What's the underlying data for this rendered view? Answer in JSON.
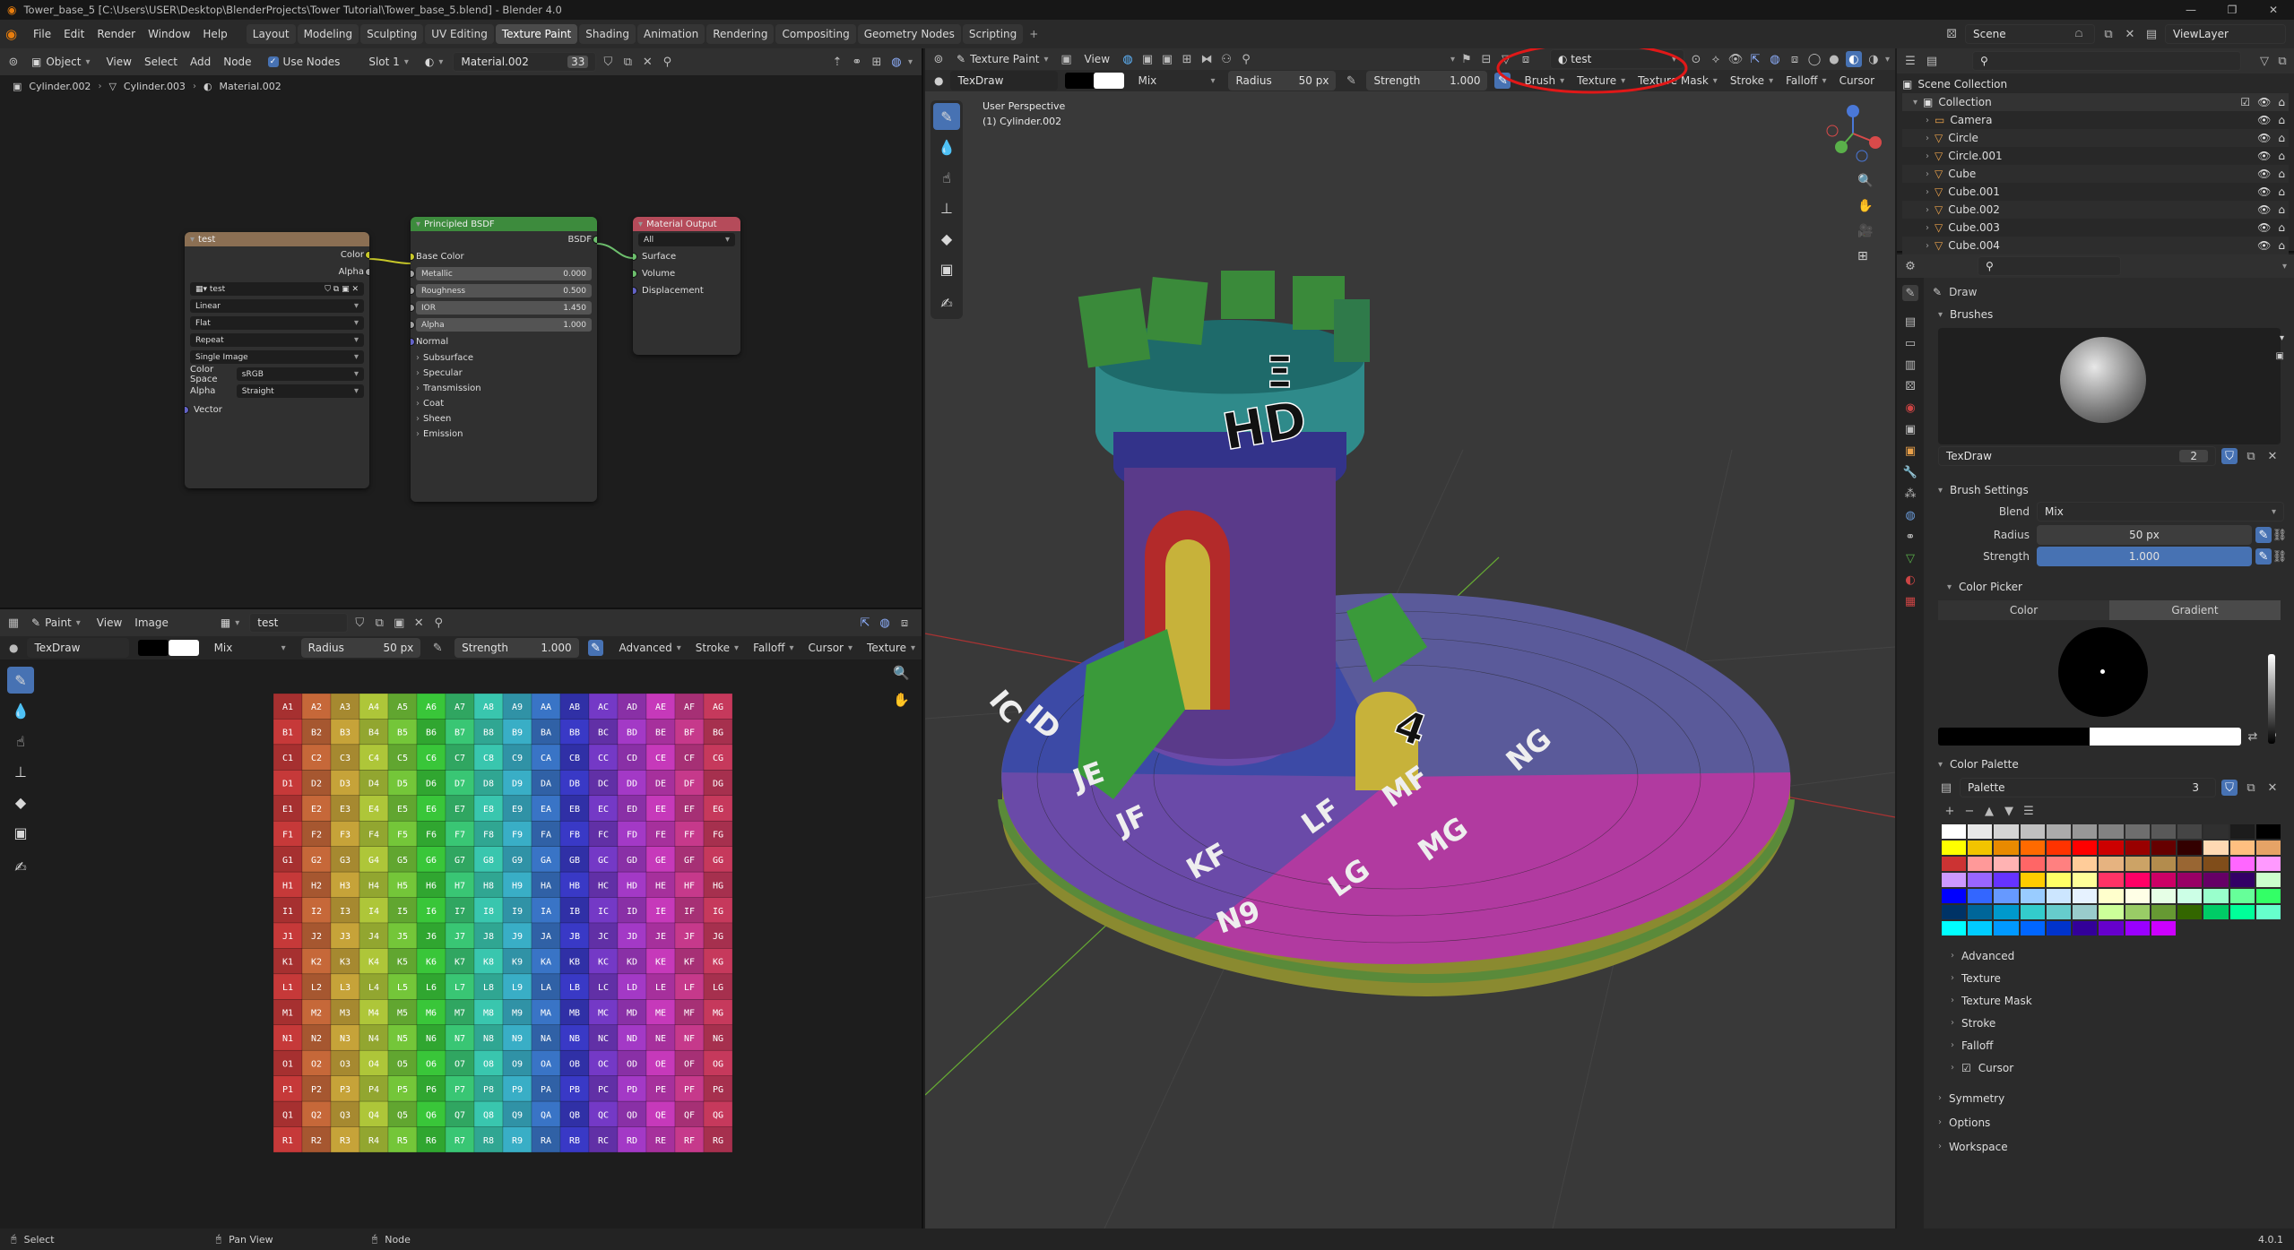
{
  "window": {
    "title": "Tower_base_5 [C:\\Users\\USER\\Desktop\\BlenderProjects\\Tower Tutorial\\Tower_base_5.blend] - Blender 4.0"
  },
  "menu": [
    "File",
    "Edit",
    "Render",
    "Window",
    "Help"
  ],
  "workspaces": [
    "Layout",
    "Modeling",
    "Sculpting",
    "UV Editing",
    "Texture Paint",
    "Shading",
    "Animation",
    "Rendering",
    "Compositing",
    "Geometry Nodes",
    "Scripting"
  ],
  "active_workspace": "Texture Paint",
  "scene": {
    "name": "Scene",
    "view_layer": "ViewLayer"
  },
  "node_editor": {
    "header": {
      "mode": "Object",
      "menus": [
        "View",
        "Select",
        "Add",
        "Node"
      ],
      "use_nodes": "Use Nodes",
      "slot": "Slot 1",
      "material": "Material.002",
      "users": "33"
    },
    "breadcrumb": [
      "Cylinder.002",
      "Cylinder.003",
      "Material.002"
    ],
    "image_node": {
      "title": "test",
      "out_color": "Color",
      "out_alpha": "Alpha",
      "image": "test",
      "interpolation": "Linear",
      "projection": "Flat",
      "extension": "Repeat",
      "source": "Single Image",
      "color_space_label": "Color Space",
      "color_space": "sRGB",
      "alpha_label": "Alpha",
      "alpha": "Straight",
      "vector": "Vector"
    },
    "bsdf_node": {
      "title": "Principled BSDF",
      "out": "BSDF",
      "base_color": "Base Color",
      "fields": [
        {
          "label": "Metallic",
          "value": "0.000"
        },
        {
          "label": "Roughness",
          "value": "0.500"
        },
        {
          "label": "IOR",
          "value": "1.450"
        },
        {
          "label": "Alpha",
          "value": "1.000"
        }
      ],
      "normal": "Normal",
      "panels": [
        "Subsurface",
        "Specular",
        "Transmission",
        "Coat",
        "Sheen",
        "Emission"
      ]
    },
    "output_node": {
      "title": "Material Output",
      "target": "All",
      "inputs": [
        "Surface",
        "Volume",
        "Displacement"
      ]
    }
  },
  "image_editor": {
    "header": {
      "mode": "Paint",
      "menus": [
        "View",
        "Image"
      ],
      "image": "test"
    },
    "toolsettings": {
      "brush": "TexDraw",
      "blend": "Mix",
      "radius_label": "Radius",
      "radius": "50 px",
      "strength_label": "Strength",
      "strength": "1.000",
      "menus": [
        "Advanced",
        "Stroke",
        "Falloff",
        "Cursor",
        "Texture"
      ]
    },
    "grid": {
      "rows": [
        "A",
        "B",
        "C",
        "D",
        "E",
        "F",
        "G",
        "H",
        "I",
        "J",
        "K",
        "L",
        "M",
        "N",
        "O",
        "P",
        "Q",
        "R"
      ],
      "cols": [
        "1",
        "2",
        "3",
        "4",
        "5",
        "6",
        "7",
        "8",
        "9",
        "A",
        "B",
        "C",
        "D",
        "E",
        "F",
        "G"
      ]
    }
  },
  "viewport": {
    "header": {
      "mode": "Texture Paint",
      "menus": [
        "View"
      ],
      "texture_slot": "test"
    },
    "toolsettings": {
      "brush": "TexDraw",
      "blend": "Mix",
      "radius_label": "Radius",
      "radius": "50 px",
      "strength_label": "Strength",
      "strength": "1.000",
      "menus": [
        "Brush",
        "Texture",
        "Texture Mask",
        "Stroke",
        "Falloff",
        "Cursor"
      ]
    },
    "overlay_text": {
      "perspective": "User Perspective",
      "object": "(1) Cylinder.002"
    }
  },
  "outliner": {
    "root": "Scene Collection",
    "collection": "Collection",
    "items": [
      "Camera",
      "Circle",
      "Circle.001",
      "Cube",
      "Cube.001",
      "Cube.002",
      "Cube.003",
      "Cube.004"
    ]
  },
  "properties": {
    "tool_name": "Draw",
    "brushes_label": "Brushes",
    "brush_name": "TexDraw",
    "brush_users": "2",
    "brush_settings_label": "Brush Settings",
    "blend_label": "Blend",
    "blend": "Mix",
    "radius_label": "Radius",
    "radius": "50 px",
    "strength_label": "Strength",
    "strength": "1.000",
    "color_picker_label": "Color Picker",
    "tabs": [
      "Color",
      "Gradient"
    ],
    "color_palette_label": "Color Palette",
    "palette_name": "Palette",
    "palette_users": "3",
    "palette_colors": [
      "#ffffff",
      "#e8e8e8",
      "#d4d4d4",
      "#c0c0c0",
      "#ababab",
      "#979797",
      "#828282",
      "#6e6e6e",
      "#595959",
      "#454545",
      "#303030",
      "#1c1c1c",
      "#000000",
      "#ffff00",
      "#f2c400",
      "#e88a00",
      "#ff6a00",
      "#ff3300",
      "#ff0000",
      "#cc0000",
      "#990000",
      "#660000",
      "#330000",
      "#ffd9b3",
      "#ffbf80",
      "#e6a366",
      "#cc3333",
      "#ff9999",
      "#ffb3b3",
      "#ff6666",
      "#ff8080",
      "#ffcc99",
      "#e6b380",
      "#cca366",
      "#b38c4d",
      "#996633",
      "#804d1a",
      "#ff66ff",
      "#ff99ff",
      "#cc99ff",
      "#9966ff",
      "#6633ff",
      "#ffcc00",
      "#ffff66",
      "#ffff99",
      "#ff3366",
      "#ff0066",
      "#cc0066",
      "#990066",
      "#660066",
      "#330066",
      "#ccffcc",
      "#0000ff",
      "#3366ff",
      "#6699ff",
      "#99ccff",
      "#cce6ff",
      "#e6f2ff",
      "#ffffcc",
      "#ffffe6",
      "#e6ffe6",
      "#ccffe6",
      "#99ffcc",
      "#66ff99",
      "#33ff66",
      "#003366",
      "#006699",
      "#0099cc",
      "#33cccc",
      "#66cccc",
      "#99cccc",
      "#ccff99",
      "#99cc66",
      "#669933",
      "#336600",
      "#00cc66",
      "#00ff99",
      "#66ffcc",
      "#00ffff",
      "#00ccff",
      "#0099ff",
      "#0066ff",
      "#0033cc",
      "#330099",
      "#6600cc",
      "#9900ff",
      "#cc00ff"
    ],
    "collapsed": [
      "Advanced",
      "Texture",
      "Texture Mask",
      "Stroke",
      "Falloff",
      "Cursor"
    ],
    "bottom_sections": [
      "Symmetry",
      "Options",
      "Workspace"
    ]
  },
  "status_bar": {
    "items": [
      "Select",
      "Pan View",
      "Node"
    ],
    "version": "4.0.1"
  }
}
